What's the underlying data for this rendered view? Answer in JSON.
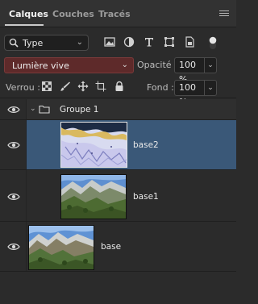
{
  "tabs": [
    {
      "label": "Calques",
      "active": true
    },
    {
      "label": "Couches",
      "active": false
    },
    {
      "label": "Tracés",
      "active": false
    }
  ],
  "filter": {
    "selected": "Type"
  },
  "blend_mode": {
    "selected": "Lumière vive"
  },
  "opacity": {
    "label": "Opacité :",
    "value": "100 %"
  },
  "lock": {
    "label": "Verrou :"
  },
  "fill": {
    "label": "Fond :",
    "value": "100 %"
  },
  "layers": {
    "group": {
      "name": "Groupe 1"
    },
    "items": [
      {
        "name": "base2",
        "selected": true
      },
      {
        "name": "base1",
        "selected": false
      },
      {
        "name": "base",
        "selected": false
      }
    ]
  },
  "colors": {
    "selected_row": "#3a5878",
    "blend_highlight": "#5e2a2a",
    "panel_bg": "#2b2b2b"
  }
}
